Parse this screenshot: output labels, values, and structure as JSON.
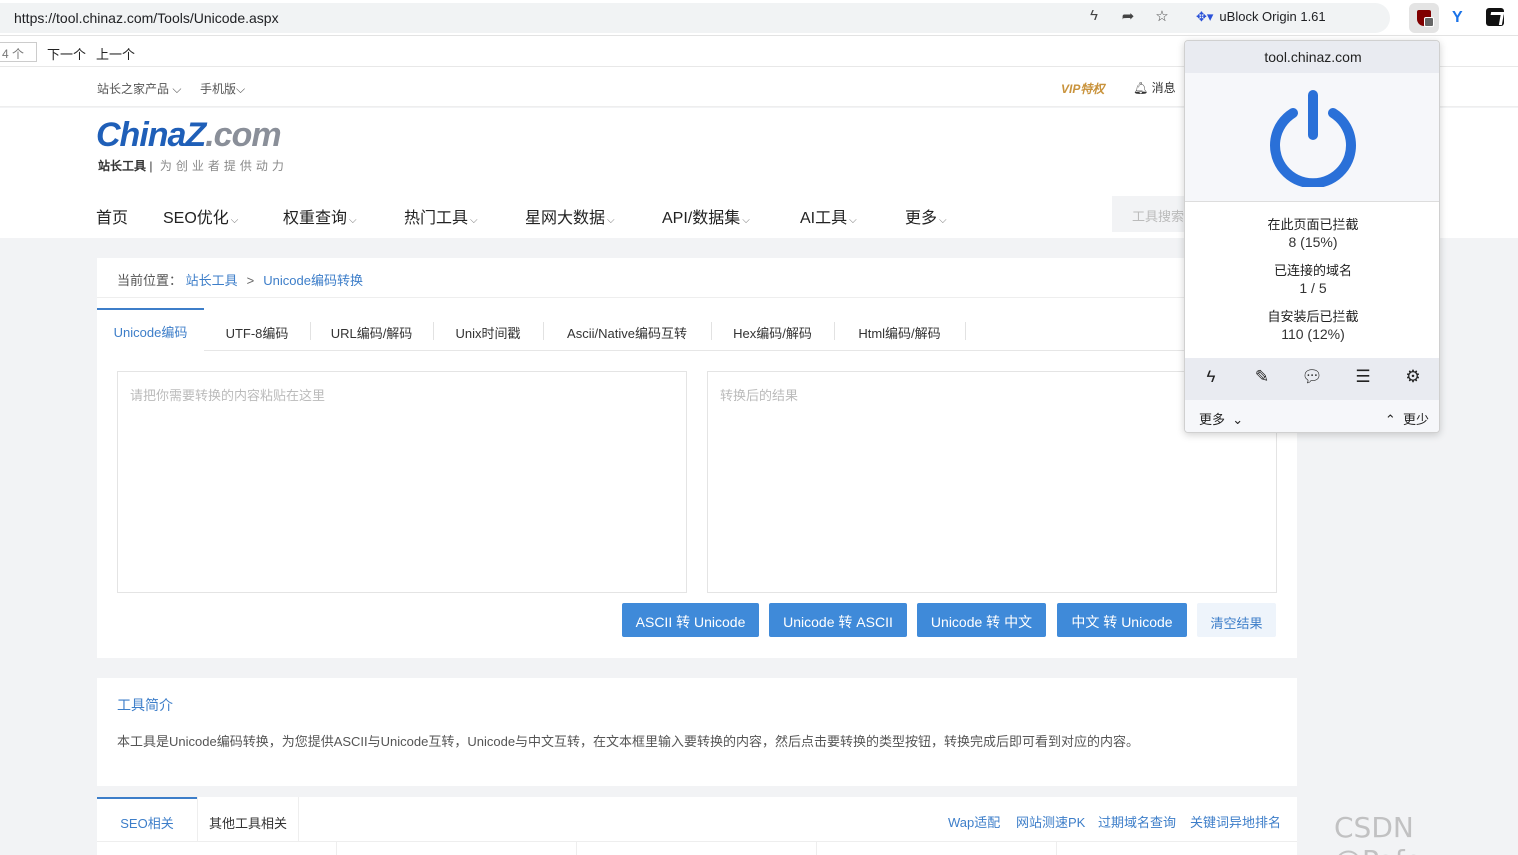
{
  "browser": {
    "url": "https://tool.chinaz.com/Tools/Unicode.aspx",
    "extension_label": "uBlock Origin 1.61",
    "find": {
      "count": "4 个",
      "next": "下一个",
      "prev": "上一个"
    }
  },
  "site": {
    "topnav": {
      "products": "站长之家产品",
      "mobile": "手机版",
      "vip": "VIP特权",
      "messages": "消息"
    },
    "logo": {
      "main": "ChinaZ",
      "tld": ".com",
      "sub_bold": "站长工具",
      "sub_slogan": "为创业者提供动力"
    },
    "nav": [
      {
        "label": "首页",
        "chevron": false
      },
      {
        "label": "SEO优化",
        "chevron": true
      },
      {
        "label": "权重查询",
        "chevron": true
      },
      {
        "label": "热门工具",
        "chevron": true
      },
      {
        "label": "星网大数据",
        "chevron": true
      },
      {
        "label": "API/数据集",
        "chevron": true
      },
      {
        "label": "AI工具",
        "chevron": true
      },
      {
        "label": "更多",
        "chevron": true
      }
    ],
    "search_placeholder": "工具搜索",
    "breadcrumb": {
      "prefix": "当前位置：",
      "home": "站长工具",
      "sep": ">",
      "current": "Unicode编码转换"
    },
    "tabs": [
      "Unicode编码",
      "UTF-8编码",
      "URL编码/解码",
      "Unix时间戳",
      "Ascii/Native编码互转",
      "Hex编码/解码",
      "Html编码/解码"
    ],
    "input_placeholder": "请把你需要转换的内容粘贴在这里",
    "output_placeholder": "转换后的结果",
    "buttons": [
      "ASCII 转 Unicode",
      "Unicode 转 ASCII",
      "Unicode 转 中文",
      "中文 转 Unicode",
      "清空结果"
    ],
    "intro": {
      "title": "工具简介",
      "text": "本工具是Unicode编码转换，为您提供ASCII与Unicode互转，Unicode与中文互转，在文本框里输入要转换的内容，然后点击要转换的类型按钮，转换完成后即可看到对应的内容。"
    },
    "related": {
      "tabs": [
        "SEO相关",
        "其他工具相关"
      ],
      "links": [
        "Wap适配",
        "网站测速PK",
        "过期域名查询",
        "关键词异地排名"
      ]
    }
  },
  "ublock": {
    "domain": "tool.chinaz.com",
    "stats": [
      {
        "label": "在此页面已拦截",
        "value": "8 (15%)"
      },
      {
        "label": "已连接的域名",
        "value": "1 / 5"
      },
      {
        "label": "自安装后已拦截",
        "value": "110 (12%)"
      }
    ],
    "more": "更多",
    "less": "更少",
    "power_color": "#2a70d8"
  },
  "watermark": "CSDN @Pafey"
}
